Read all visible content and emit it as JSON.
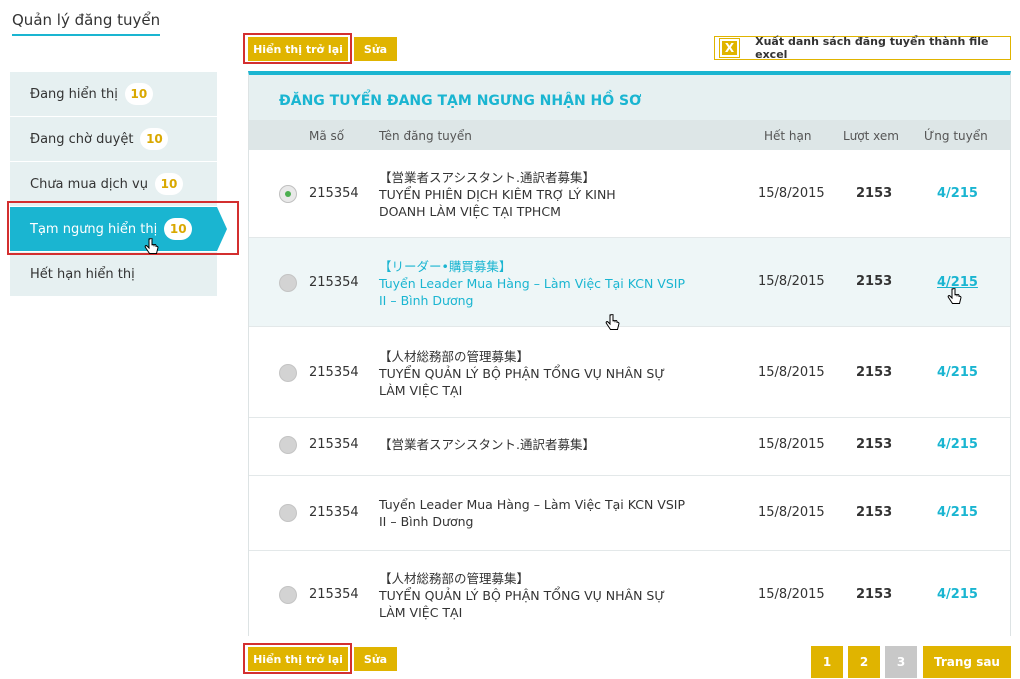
{
  "page": {
    "title": "Quản lý đăng tuyển"
  },
  "sidebar": {
    "items": [
      {
        "label": "Đang hiển thị",
        "count": "10"
      },
      {
        "label": "Đang chờ duyệt",
        "count": "10"
      },
      {
        "label": "Chưa mua dịch vụ",
        "count": "10"
      },
      {
        "label": "Tạm ngưng hiển thị",
        "count": "10"
      },
      {
        "label": "Hết hạn hiển thị"
      }
    ]
  },
  "toolbar": {
    "show_again": "Hiển thị trở lại",
    "edit": "Sửa",
    "export_icon": "X",
    "export_label": "Xuất danh sách đăng tuyển thành file excel"
  },
  "panel": {
    "title": "ĐĂNG TUYỂN ĐANG TẠM NGƯNG NHẬN HỒ SƠ",
    "columns": {
      "code": "Mã số",
      "name": "Tên đăng tuyển",
      "expires": "Hết hạn",
      "views": "Lượt xem",
      "applications": "Ứng tuyển"
    }
  },
  "rows": [
    {
      "code": "215354",
      "line1": "【営業者スアシスタント.通訳者募集】",
      "line2": "TUYỂN PHIÊN DỊCH KIÊM TRỢ LÝ KINH",
      "line3": "DOANH LÀM VIỆC TẠI TPHCM",
      "expires": "15/8/2015",
      "views": "2153",
      "applications": "4/215"
    },
    {
      "code": "215354",
      "line1": "【リーダー•購買募集】",
      "line2": "Tuyển Leader Mua Hàng – Làm Việc Tại KCN VSIP",
      "line3": "II – Bình Dương",
      "expires": "15/8/2015",
      "views": "2153",
      "applications": "4/215"
    },
    {
      "code": "215354",
      "line1": "【人材総務部の管理募集】",
      "line2": "TUYỂN QUẢN LÝ BỘ PHẬN TỔNG VỤ NHÂN SỰ",
      "line3": "LÀM VIỆC TẠI",
      "expires": "15/8/2015",
      "views": "2153",
      "applications": "4/215"
    },
    {
      "code": "215354",
      "line1": "【営業者スアシスタント.通訳者募集】",
      "expires": "15/8/2015",
      "views": "2153",
      "applications": "4/215"
    },
    {
      "code": "215354",
      "line1": "Tuyển Leader Mua Hàng – Làm Việc Tại KCN VSIP",
      "line2": "II – Bình Dương",
      "expires": "15/8/2015",
      "views": "2153",
      "applications": "4/215"
    },
    {
      "code": "215354",
      "line1": "【人材総務部の管理募集】",
      "line2": "TUYỂN QUẢN LÝ BỘ PHẬN TỔNG VỤ NHÂN SỰ",
      "line3": "LÀM VIỆC TẠI",
      "expires": "15/8/2015",
      "views": "2153",
      "applications": "4/215"
    }
  ],
  "pagination": {
    "p1": "1",
    "p2": "2",
    "p3": "3",
    "next": "Trang sau"
  }
}
